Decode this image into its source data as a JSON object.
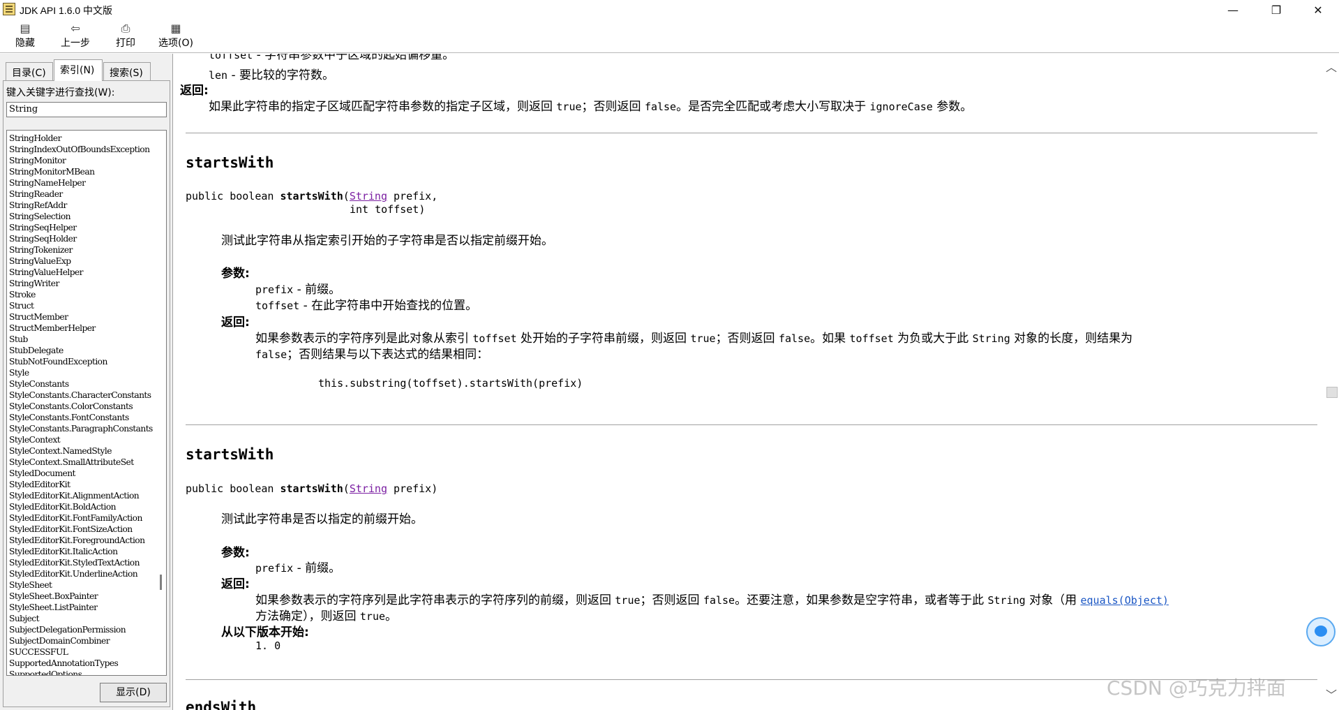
{
  "window": {
    "title": "JDK API 1.6.0 中文版",
    "controls": {
      "minimize": "—",
      "restore": "❐",
      "close": "✕"
    }
  },
  "toolbar": {
    "hide": {
      "label": "隐藏",
      "icon": "hide-icon"
    },
    "back": {
      "label": "上一步",
      "icon": "back-arrow-icon"
    },
    "print": {
      "label": "打印",
      "icon": "printer-icon"
    },
    "options": {
      "label": "选项(O)",
      "icon": "options-icon"
    }
  },
  "nav": {
    "tabs": {
      "contents": "目录(C)",
      "index": "索引(N)",
      "search": "搜索(S)"
    },
    "keyword_label": "键入关键字进行查找(W):",
    "keyword_value": "String",
    "display_button": "显示(D)",
    "index_items": [
      "StringHolder",
      "StringIndexOutOfBoundsException",
      "StringMonitor",
      "StringMonitorMBean",
      "StringNameHelper",
      "StringReader",
      "StringRefAddr",
      "StringSelection",
      "StringSeqHelper",
      "StringSeqHolder",
      "StringTokenizer",
      "StringValueExp",
      "StringValueHelper",
      "StringWriter",
      "Stroke",
      "Struct",
      "StructMember",
      "StructMemberHelper",
      "Stub",
      "StubDelegate",
      "StubNotFoundException",
      "Style",
      "StyleConstants",
      "StyleConstants.CharacterConstants",
      "StyleConstants.ColorConstants",
      "StyleConstants.FontConstants",
      "StyleConstants.ParagraphConstants",
      "StyleContext",
      "StyleContext.NamedStyle",
      "StyleContext.SmallAttributeSet",
      "StyledDocument",
      "StyledEditorKit",
      "StyledEditorKit.AlignmentAction",
      "StyledEditorKit.BoldAction",
      "StyledEditorKit.FontFamilyAction",
      "StyledEditorKit.FontSizeAction",
      "StyledEditorKit.ForegroundAction",
      "StyledEditorKit.ItalicAction",
      "StyledEditorKit.StyledTextAction",
      "StyledEditorKit.UnderlineAction",
      "StyleSheet",
      "StyleSheet.BoxPainter",
      "StyleSheet.ListPainter",
      "Subject",
      "SubjectDelegationPermission",
      "SubjectDomainCombiner",
      "SUCCESSFUL",
      "SupportedAnnotationTypes",
      "SupportedOptions"
    ]
  },
  "content": {
    "top_fragment": {
      "param_toffset": "toffset",
      "param_toffset_desc": " - 字符串参数中子区域的起始偏移量。",
      "param_len": "len",
      "param_len_desc": " - 要比较的字符数。",
      "returns_label": "返回:",
      "returns_text_1": "如果此字符串的指定子区域匹配字符串参数的指定子区域，则返回 ",
      "returns_code_true": "true",
      "returns_text_2": "；否则返回 ",
      "returns_code_false": "false",
      "returns_text_3": "。是否完全匹配或考虑大小写取决于 ",
      "returns_code_ignore": "ignoreCase",
      "returns_text_4": " 参数。"
    },
    "method1": {
      "heading": "startsWith",
      "sig_prefix": "public boolean ",
      "sig_name": "startsWith",
      "sig_open": "(",
      "sig_type": "String",
      "sig_param1": " prefix,",
      "sig_line2": "int toffset)",
      "description": "测试此字符串从指定索引开始的子字符串是否以指定前缀开始。",
      "params_label": "参数:",
      "p1_name": "prefix",
      "p1_desc": " - 前缀。",
      "p2_name": "toffset",
      "p2_desc": " - 在此字符串中开始查找的位置。",
      "returns_label": "返回:",
      "r_text_1": "如果参数表示的字符序列是此对象从索引 ",
      "r_code_toffset": "toffset",
      "r_text_2": " 处开始的子字符串前缀，则返回 ",
      "r_code_true": "true",
      "r_text_3": "；否则返回 ",
      "r_code_false": "false",
      "r_text_4": "。如果 ",
      "r_code_toffset2": "toffset",
      "r_text_5": " 为负或大于此 ",
      "r_code_string": "String",
      "r_text_6": " 对象的长度，则结果为",
      "r_line2_code": "false",
      "r_line2_text": "；否则结果与以下表达式的结果相同：",
      "code_example": "this.substring(toffset).startsWith(prefix)"
    },
    "method2": {
      "heading": "startsWith",
      "sig_prefix": "public boolean ",
      "sig_name": "startsWith",
      "sig_open": "(",
      "sig_type": "String",
      "sig_param1": " prefix)",
      "description": "测试此字符串是否以指定的前缀开始。",
      "params_label": "参数:",
      "p1_name": "prefix",
      "p1_desc": " - 前缀。",
      "returns_label": "返回:",
      "r_text_1": "如果参数表示的字符序列是此字符串表示的字符序列的前缀，则返回 ",
      "r_code_true": "true",
      "r_text_2": "；否则返回 ",
      "r_code_false": "false",
      "r_text_3": "。还要注意，如果参数是空字符串，或者等于此 ",
      "r_code_string": "String",
      "r_text_4": " 对象（用 ",
      "r_link_equals": "equals(Object)",
      "r_line2_text": "方法确定），则返回 ",
      "r_line2_code": "true",
      "r_line2_end": "。",
      "since_label": "从以下版本开始:",
      "since_value": "1. 0"
    },
    "method3": {
      "heading": "endsWith"
    }
  },
  "watermark": "CSDN @巧克力拌面",
  "colors": {
    "link_visited": "#7b1fa2",
    "link": "#1a56c4",
    "panel_bg": "#f0f0f0"
  }
}
